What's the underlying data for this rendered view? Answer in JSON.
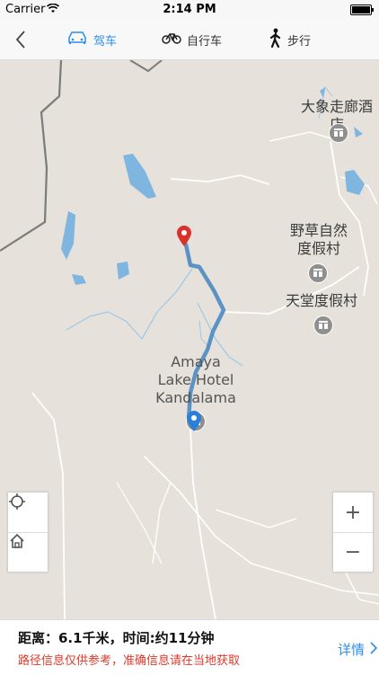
{
  "status_bar": {
    "carrier": "Carrier",
    "time": "2:14 PM"
  },
  "nav": {
    "modes": [
      {
        "label": "驾车",
        "icon": "car-icon",
        "active": true
      },
      {
        "label": "自行车",
        "icon": "bicycle-icon",
        "active": false
      },
      {
        "label": "步行",
        "icon": "walking-person-icon",
        "active": false
      }
    ]
  },
  "map": {
    "labels": {
      "elephant_hotel": "大象走廊酒店",
      "wild_grass_resort": "野草自然度假村",
      "paradise_resort": "天堂度假村",
      "amaya": "Amaya Lake Hotel Kandalama"
    },
    "colors": {
      "route": "#5b94c4",
      "water": "#7fb6e0",
      "destination_pin": "#d9322b",
      "origin_pin": "#2a7fd8"
    }
  },
  "controls": {
    "zoom_in": "+",
    "zoom_out": "−"
  },
  "footer": {
    "distance_text": "距离：6.1千米，时间:约11分钟",
    "notice": "路径信息仅供参考，准确信息请在当地获取",
    "details_label": "详情"
  }
}
